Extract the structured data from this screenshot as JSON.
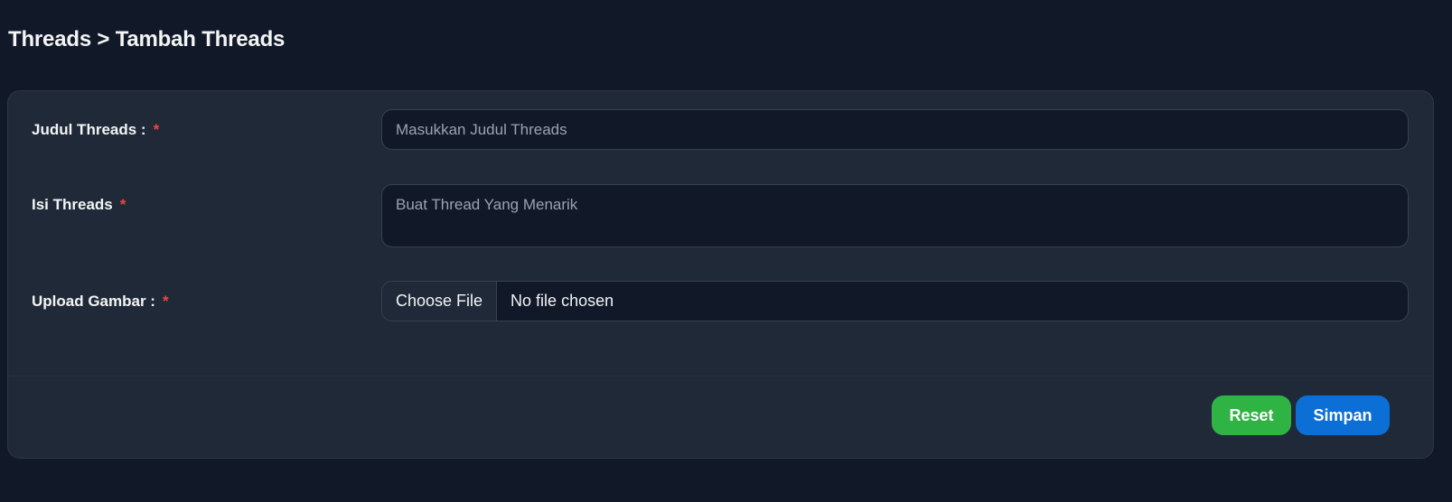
{
  "breadcrumb": {
    "text": "Threads > Tambah Threads"
  },
  "form": {
    "title_field": {
      "label": "Judul Threads :",
      "required_mark": "*",
      "placeholder": "Masukkan Judul Threads"
    },
    "content_field": {
      "label": "Isi Threads",
      "required_mark": "*",
      "placeholder": "Buat Thread Yang Menarik"
    },
    "image_field": {
      "label": "Upload Gambar :",
      "required_mark": "*",
      "button_label": "Choose File",
      "status": "No file chosen"
    }
  },
  "actions": {
    "reset_label": "Reset",
    "save_label": "Simpan"
  },
  "colors": {
    "background": "#111827",
    "card": "#1f2937",
    "required": "#ef4444",
    "reset": "#2fb344",
    "save": "#0b6fd6"
  }
}
